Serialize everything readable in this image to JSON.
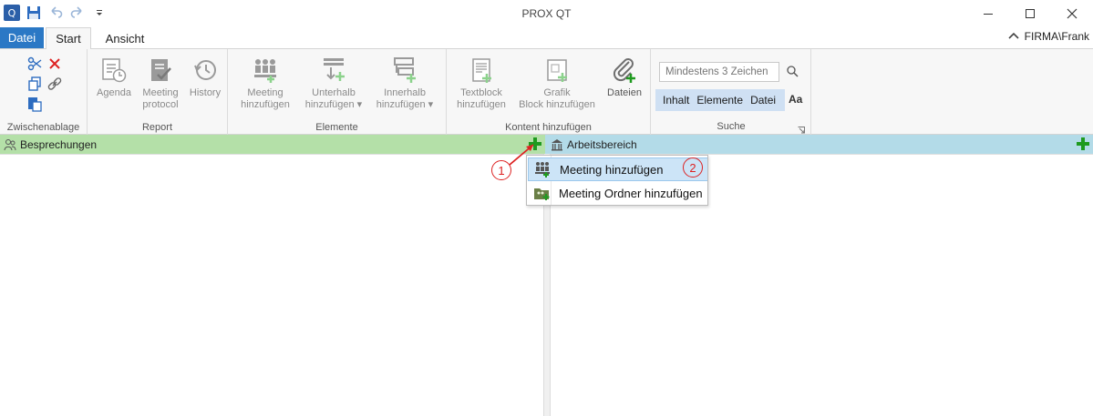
{
  "window": {
    "title": "PROX QT"
  },
  "tabs": {
    "file": "Datei",
    "start": "Start",
    "view": "Ansicht"
  },
  "user": {
    "name": "FIRMA\\Frank"
  },
  "ribbon": {
    "clipboard": {
      "label": "Zwischenablage"
    },
    "report": {
      "label": "Report",
      "agenda": "Agenda",
      "meeting_protocol_1": "Meeting",
      "meeting_protocol_2": "protocol",
      "history": "History"
    },
    "elements": {
      "label": "Elemente",
      "add_meeting_1": "Meeting",
      "add_meeting_2": "hinzufügen",
      "below_1": "Unterhalb",
      "below_2": "hinzufügen ▾",
      "inside_1": "Innerhalb",
      "inside_2": "hinzufügen ▾"
    },
    "content": {
      "label": "Kontent hinzufügen",
      "textblock_1": "Textblock",
      "textblock_2": "hinzufügen",
      "grafik_1": "Grafik",
      "grafik_2": "Block hinzufügen",
      "files": "Dateien"
    },
    "search": {
      "label": "Suche",
      "placeholder": "Mindestens 3 Zeichen",
      "filter_content": "Inhalt",
      "filter_elements": "Elemente",
      "filter_file": "Datei",
      "match_case": "Aa"
    }
  },
  "panes": {
    "left_title": "Besprechungen",
    "right_title": "Arbeitsbereich"
  },
  "menu": {
    "items": [
      {
        "label": "Meeting hinzufügen"
      },
      {
        "label": "Meeting Ordner hinzufügen"
      }
    ]
  },
  "annotations": {
    "marker1": "1",
    "marker2": "2"
  },
  "colors": {
    "file_tab": "#2b78c5",
    "left_header": "#b4e0a8",
    "right_header": "#b3dbe8",
    "add_green": "#1f9a1f",
    "annotation_red": "#dd2222",
    "menu_highlight": "#cce4f7"
  }
}
